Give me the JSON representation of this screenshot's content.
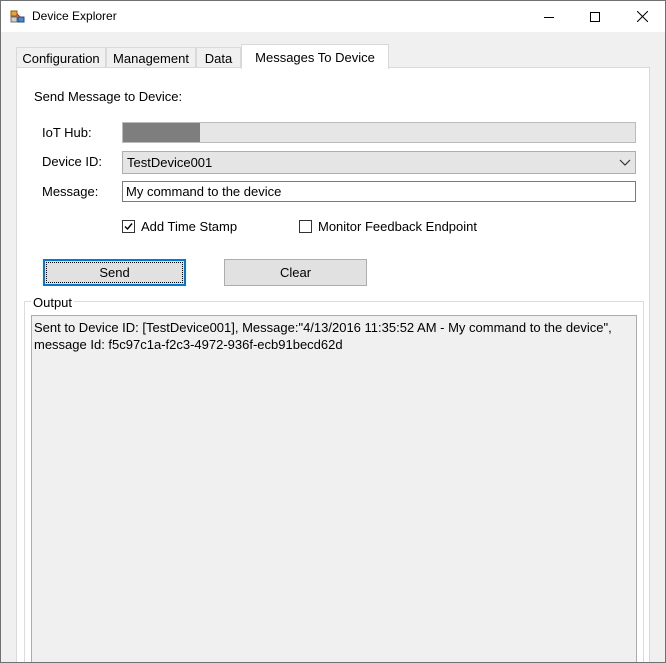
{
  "window": {
    "title": "Device Explorer"
  },
  "tabs": [
    {
      "label": "Configuration"
    },
    {
      "label": "Management"
    },
    {
      "label": "Data"
    },
    {
      "label": "Messages To Device"
    }
  ],
  "messages_tab": {
    "heading": "Send Message to Device:",
    "iot_hub_label": "IoT Hub:",
    "iot_hub_progress": 0.15,
    "device_id_label": "Device ID:",
    "device_id_value": "TestDevice001",
    "message_label": "Message:",
    "message_value": "My command to the device",
    "add_timestamp_label": "Add Time Stamp",
    "add_timestamp_checked": true,
    "monitor_feedback_label": "Monitor Feedback Endpoint",
    "monitor_feedback_checked": false,
    "send_label": "Send",
    "clear_label": "Clear",
    "output_label": "Output",
    "output_text": "Sent to Device ID: [TestDevice001], Message:\"4/13/2016 11:35:52 AM - My command to the device\",\nmessage Id: f5c97c1a-f2c3-4972-936f-ecb91becd62d"
  }
}
